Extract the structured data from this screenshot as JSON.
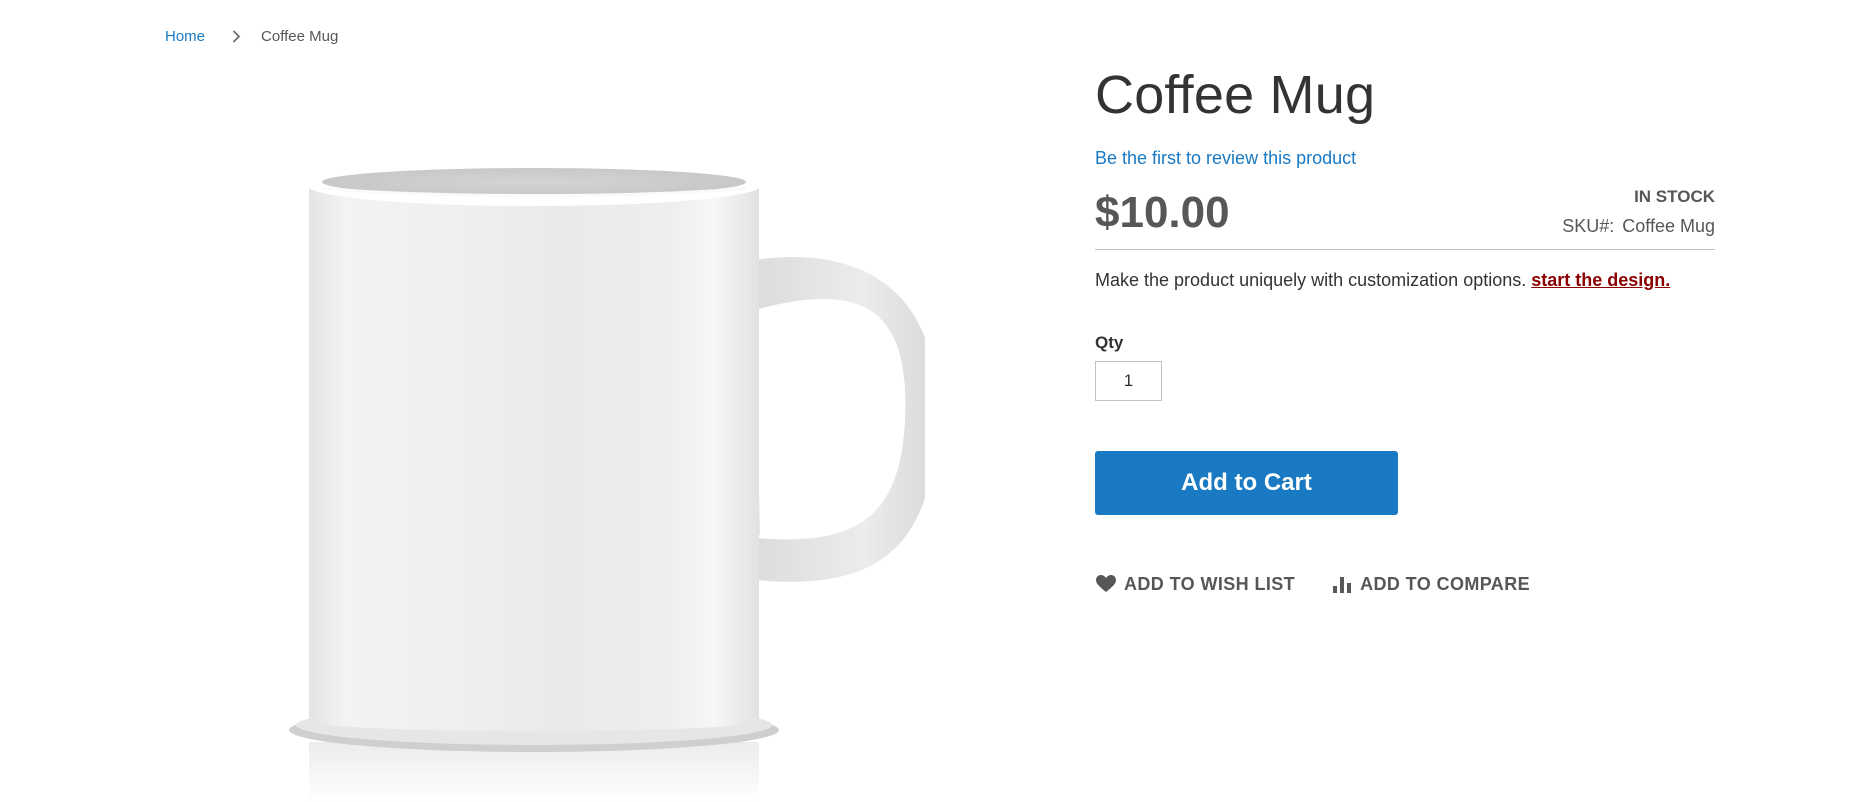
{
  "breadcrumb": {
    "home_label": "Home",
    "current_label": "Coffee Mug"
  },
  "product": {
    "name": "Coffee Mug",
    "review_link_text": "Be the first to review this product",
    "price": "$10.00",
    "stock_status": "IN STOCK",
    "sku_label": "SKU#:",
    "sku_value": "Coffee Mug",
    "customization_text": "Make the product uniquely with customization options.",
    "customization_link_text": "start the design.",
    "image_icon": "coffee-mug-image"
  },
  "form": {
    "qty_label": "Qty",
    "qty_value": "1",
    "add_to_cart_label": "Add to Cart"
  },
  "actions": {
    "wishlist_label": "ADD TO WISH LIST",
    "wishlist_icon": "heart-icon",
    "compare_label": "ADD TO COMPARE",
    "compare_icon": "bar-chart-icon"
  },
  "colors": {
    "accent": "#1979c3",
    "link_dark_red": "#8b0000",
    "muted_text": "#575757"
  }
}
